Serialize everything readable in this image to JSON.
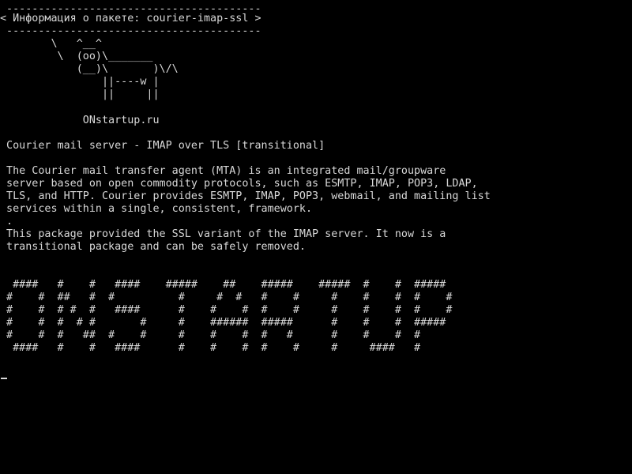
{
  "screen": {
    "lines": [
      " ----------------------------------------",
      "< Информация о пакете: courier-imap-ssl >",
      " ----------------------------------------",
      "        \\   ^__^",
      "         \\  (oo)\\_______",
      "            (__)\\       )\\/\\",
      "                ||----w |",
      "                ||     ||",
      "",
      "             ONstartup.ru",
      "",
      " Courier mail server - IMAP over TLS [transitional]",
      "",
      " The Courier mail transfer agent (MTA) is an integrated mail/groupware",
      " server based on open commodity protocols, such as ESMTP, IMAP, POP3, LDAP,",
      " TLS, and HTTP. Courier provides ESMTP, IMAP, POP3, webmail, and mailing list",
      " services within a single, consistent, framework.",
      " .",
      " This package provided the SSL variant of the IMAP server. It now is a",
      " transitional package and can be safely removed.",
      "",
      "",
      "  ####   #    #   ####    #####    ##    #####    #####  #    #  #####",
      " #    #  ##   #  #          #     #  #   #    #     #    #    #  #    #",
      " #    #  # #  #   ####      #    #    #  #    #     #    #    #  #    #",
      " #    #  #  # #       #     #    ######  #####      #    #    #  #####",
      " #    #  #   ##  #    #     #    #    #  #   #      #    #    #  #",
      "  ####   #    #   ####      #    #    #  #    #     #     ####   #"
    ]
  }
}
